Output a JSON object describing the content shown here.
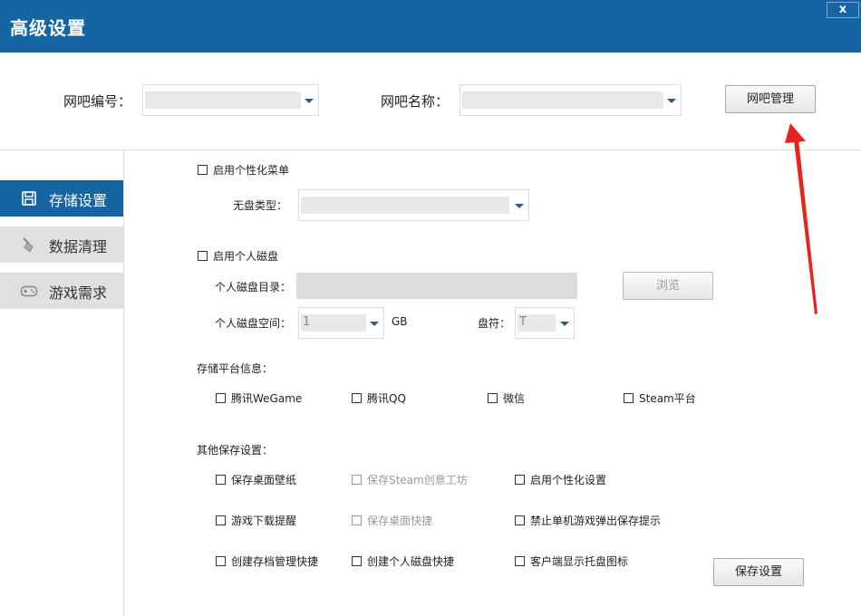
{
  "window": {
    "title": "高级设置",
    "close_label": "x"
  },
  "header": {
    "bar_id_label": "网吧编号：",
    "bar_id_value": "",
    "bar_name_label": "网吧名称：",
    "bar_name_value": "",
    "manage_button": "网吧管理"
  },
  "sidebar": {
    "items": [
      {
        "label": "存储设置",
        "icon": "floppy-icon",
        "active": true
      },
      {
        "label": "数据清理",
        "icon": "broom-icon",
        "active": false
      },
      {
        "label": "游戏需求",
        "icon": "gamepad-icon",
        "active": false
      }
    ]
  },
  "main": {
    "personal_menu": {
      "label": "启用个性化菜单",
      "checked": false
    },
    "diskless_type_label": "无盘类型：",
    "diskless_type_value": "",
    "personal_disk": {
      "label": "启用个人磁盘",
      "checked": false
    },
    "disk_dir_label": "个人磁盘目录：",
    "disk_dir_value": "",
    "browse_button": "浏览",
    "disk_space_label": "个人磁盘空间：",
    "disk_space_value": "1",
    "disk_space_unit": "GB",
    "drive_letter_label": "盘符：",
    "drive_letter_value": "T",
    "platform_section": "存储平台信息：",
    "platforms": [
      {
        "label": "腾讯WeGame",
        "checked": false
      },
      {
        "label": "腾讯QQ",
        "checked": false
      },
      {
        "label": "微信",
        "checked": false
      },
      {
        "label": "Steam平台",
        "checked": false
      }
    ],
    "other_section": "其他保存设置：",
    "other_options": [
      {
        "label": "保存桌面壁纸",
        "enabled": true
      },
      {
        "label": "保存Steam创意工坊",
        "enabled": false
      },
      {
        "label": "启用个性化设置",
        "enabled": true
      },
      {
        "label": "游戏下载提醒",
        "enabled": true
      },
      {
        "label": "保存桌面快捷",
        "enabled": false
      },
      {
        "label": "禁止单机游戏弹出保存提示",
        "enabled": true
      },
      {
        "label": "创建存档管理快捷",
        "enabled": true
      },
      {
        "label": "创建个人磁盘快捷",
        "enabled": true
      },
      {
        "label": "客户端显示托盘图标",
        "enabled": true
      }
    ],
    "save_button": "保存设置"
  },
  "colors": {
    "accent": "#1565a3",
    "annotation": "#e8241f"
  }
}
